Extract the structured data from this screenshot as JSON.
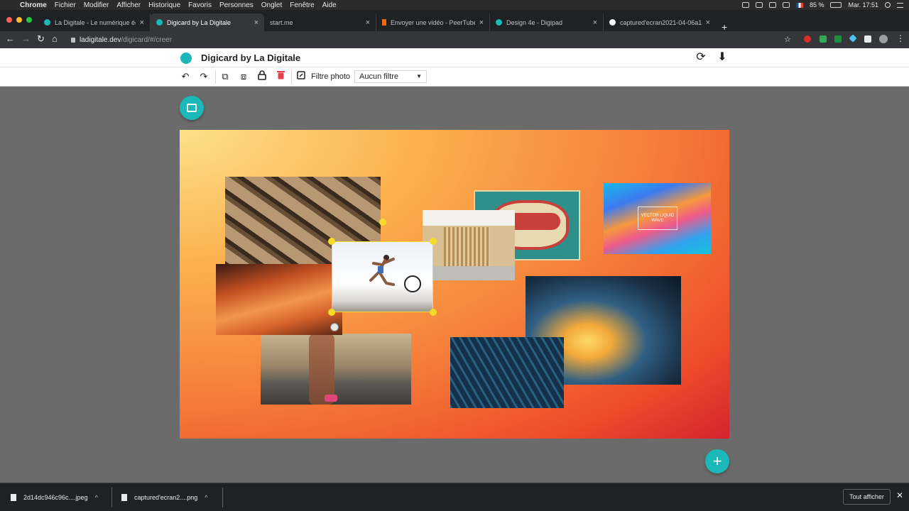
{
  "menubar": {
    "app": "Chrome",
    "items": [
      "Fichier",
      "Modifier",
      "Afficher",
      "Historique",
      "Favoris",
      "Personnes",
      "Onglet",
      "Fenêtre",
      "Aide"
    ],
    "battery": "85 %",
    "clock": "Mar. 17:51"
  },
  "tabs": [
    {
      "title": "La Digitale - Le numérique éduc",
      "fav_color": "#1ab8b8"
    },
    {
      "title": "Digicard by La Digitale",
      "fav_color": "#1ab8b8"
    },
    {
      "title": "start.me",
      "fav_color": ""
    },
    {
      "title": "Envoyer une vidéo - PeerTube",
      "fav_color": "#f1680d"
    },
    {
      "title": "Design 4e - Digipad",
      "fav_color": "#1ab8b8"
    },
    {
      "title": "captured'ecran2021-04-06a1f",
      "fav_color": "#ffffff"
    }
  ],
  "address": {
    "domain": "ladigitale.dev",
    "path": "/digicard/#/creer"
  },
  "app": {
    "title": "Digicard by La Digitale"
  },
  "toolbar": {
    "filter_label": "Filtre photo",
    "filter_value": "Aucun filtre"
  },
  "colors": {
    "accent": "#1ab8b8",
    "delete": "#e0414d",
    "handle": "#f5dc2a"
  },
  "photos": [
    {
      "name": "photo-wood-lattice"
    },
    {
      "name": "photo-hotel-sign"
    },
    {
      "name": "photo-wood-interior"
    },
    {
      "name": "photo-vector-waves",
      "text": "VECTOR LIQUID WAVE"
    },
    {
      "name": "photo-sprinter"
    },
    {
      "name": "photo-orange-canyon"
    },
    {
      "name": "photo-wave-tube"
    },
    {
      "name": "photo-runner-road"
    },
    {
      "name": "photo-blue-mesh"
    }
  ],
  "downloads": [
    {
      "file": "2d14dc946c96c....jpeg"
    },
    {
      "file": "captured'ecran2....png"
    }
  ],
  "show_all": "Tout afficher"
}
